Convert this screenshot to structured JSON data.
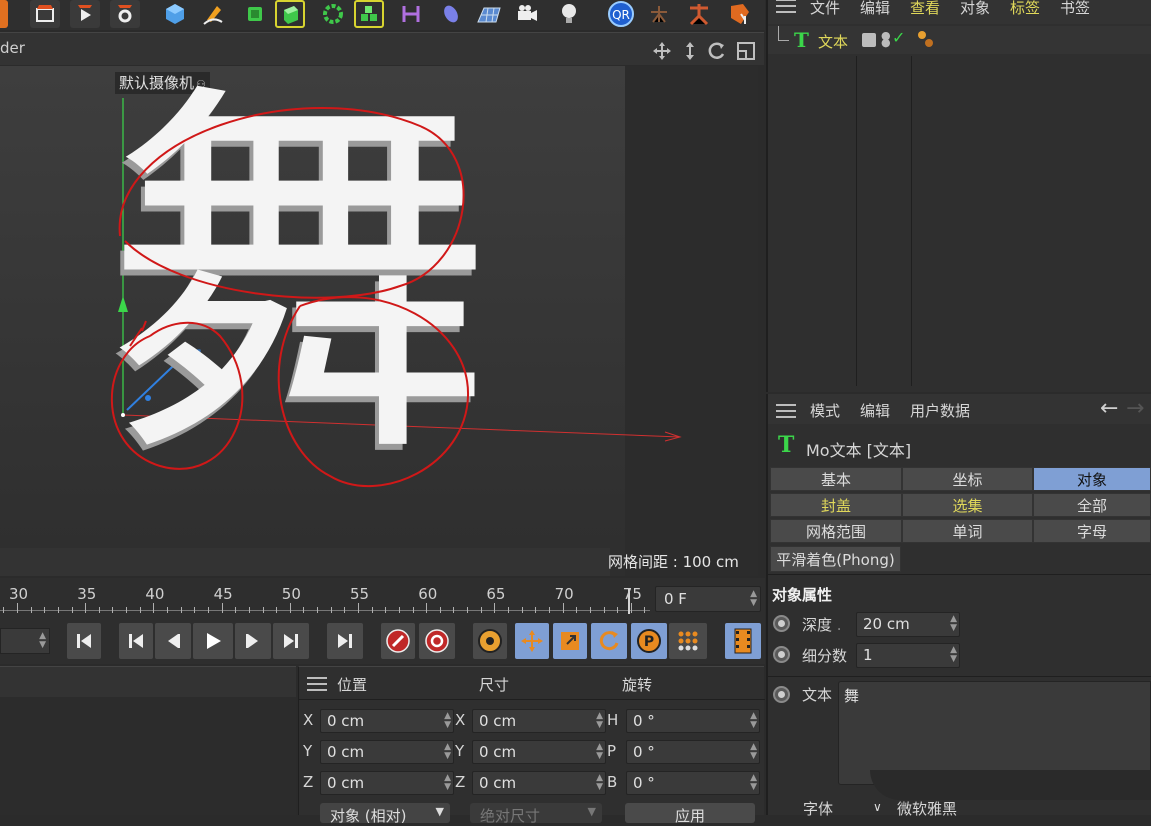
{
  "top_menu": {
    "file": "文件",
    "edit": "编辑",
    "view": "查看",
    "objects": "对象",
    "tags": "标签",
    "bookmarks": "书签"
  },
  "toolbar_icons": [
    "clapper-icon",
    "render-icon",
    "render-settings-icon",
    "cube-icon",
    "pen-icon",
    "subdivision-icon",
    "extrude-icon",
    "cloner-icon",
    "voronoi-icon",
    "deformer-icon",
    "floor-icon",
    "camera-icon",
    "light-icon",
    "qr-icon",
    "xpresso-icon",
    "character-icon",
    "tag-icon"
  ],
  "viewport": {
    "tab_label": "der",
    "camera_label": "默认摄像机",
    "glyph": "舞",
    "grid_label": "网格间距 : 100 cm",
    "nav_icons": [
      "move-view-icon",
      "dolly-icon",
      "rotate-view-icon",
      "maximize-icon"
    ]
  },
  "object_manager": {
    "item_label": "文本",
    "icon": "text-T-icon"
  },
  "timeline": {
    "ticks": [
      "30",
      "35",
      "40",
      "45",
      "50",
      "55",
      "60",
      "65",
      "70",
      "75"
    ],
    "frame_value": "0 F"
  },
  "playback_icons": [
    "go-start-icon",
    "prev-key-icon",
    "step-back-icon",
    "play-icon",
    "step-forward-icon",
    "next-key-icon",
    "go-end-icon",
    "record-icon",
    "autokey-icon",
    "keyframe-icon",
    "move-key-icon",
    "scale-key-icon",
    "rotate-key-icon",
    "param-key-icon",
    "pla-icon",
    "film-icon"
  ],
  "coordinates": {
    "headers": {
      "position": "位置",
      "size": "尺寸",
      "rotation": "旋转"
    },
    "rows": [
      {
        "axis1": "X",
        "pos": "0 cm",
        "axis2": "X",
        "size": "0 cm",
        "axis3": "H",
        "rot": "0 °"
      },
      {
        "axis1": "Y",
        "pos": "0 cm",
        "axis2": "Y",
        "size": "0 cm",
        "axis3": "P",
        "rot": "0 °"
      },
      {
        "axis1": "Z",
        "pos": "0 cm",
        "axis2": "Z",
        "size": "0 cm",
        "axis3": "B",
        "rot": "0 °"
      }
    ],
    "mode_dropdown": "对象 (相对)",
    "size_dropdown": "绝对尺寸",
    "apply_button": "应用"
  },
  "attributes": {
    "menu": {
      "mode": "模式",
      "edit": "编辑",
      "user_data": "用户数据"
    },
    "object_title": "Mo文本 [文本]",
    "tabs": [
      {
        "label": "基本",
        "active": false,
        "highlight": false
      },
      {
        "label": "坐标",
        "active": false,
        "highlight": false
      },
      {
        "label": "对象",
        "active": true,
        "highlight": false
      },
      {
        "label": "封盖",
        "active": false,
        "highlight": true
      },
      {
        "label": "选集",
        "active": false,
        "highlight": true
      },
      {
        "label": "全部",
        "active": false,
        "highlight": false
      },
      {
        "label": "网格范围",
        "active": false,
        "highlight": false
      },
      {
        "label": "单词",
        "active": false,
        "highlight": false
      },
      {
        "label": "字母",
        "active": false,
        "highlight": false
      }
    ],
    "phong_tab": "平滑着色(Phong)",
    "section_title": "对象属性",
    "depth_label": "深度",
    "depth_value": "20 cm",
    "subdiv_label": "细分数",
    "subdiv_value": "1",
    "text_label": "文本",
    "text_value": "舞",
    "font_label": "字体",
    "font_value": "微软雅黑"
  },
  "colors": {
    "accent_blue": "#7f9fd4",
    "highlight_yellow": "#e0d85a",
    "annotation_red": "#d01818",
    "bg": "#2b2b2b",
    "viewport": "#383838"
  }
}
